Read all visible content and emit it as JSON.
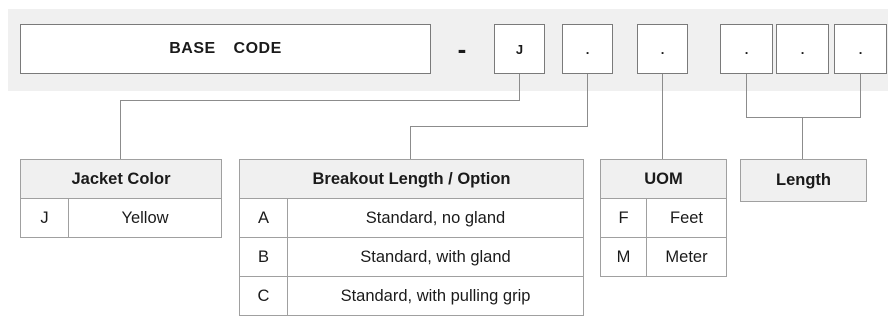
{
  "header": {
    "base_code": "BASE  CODE",
    "separator": "-",
    "segments": [
      "J",
      ".",
      ".",
      ".",
      ".",
      "."
    ]
  },
  "tables": {
    "jacket_color": {
      "title": "Jacket Color",
      "rows": [
        {
          "code": "J",
          "value": "Yellow"
        }
      ]
    },
    "breakout": {
      "title": "Breakout Length / Option",
      "rows": [
        {
          "code": "A",
          "value": "Standard, no gland"
        },
        {
          "code": "B",
          "value": "Standard, with gland"
        },
        {
          "code": "C",
          "value": "Standard, with pulling grip"
        }
      ]
    },
    "uom": {
      "title": "UOM",
      "rows": [
        {
          "code": "F",
          "value": "Feet"
        },
        {
          "code": "M",
          "value": "Meter"
        }
      ]
    },
    "length": {
      "title": "Length"
    }
  },
  "colors": {
    "band": "#f0f0f0",
    "header_cell": "#f0f0f0",
    "connector": "#8c8c8c",
    "border": "#7a7a7a"
  }
}
